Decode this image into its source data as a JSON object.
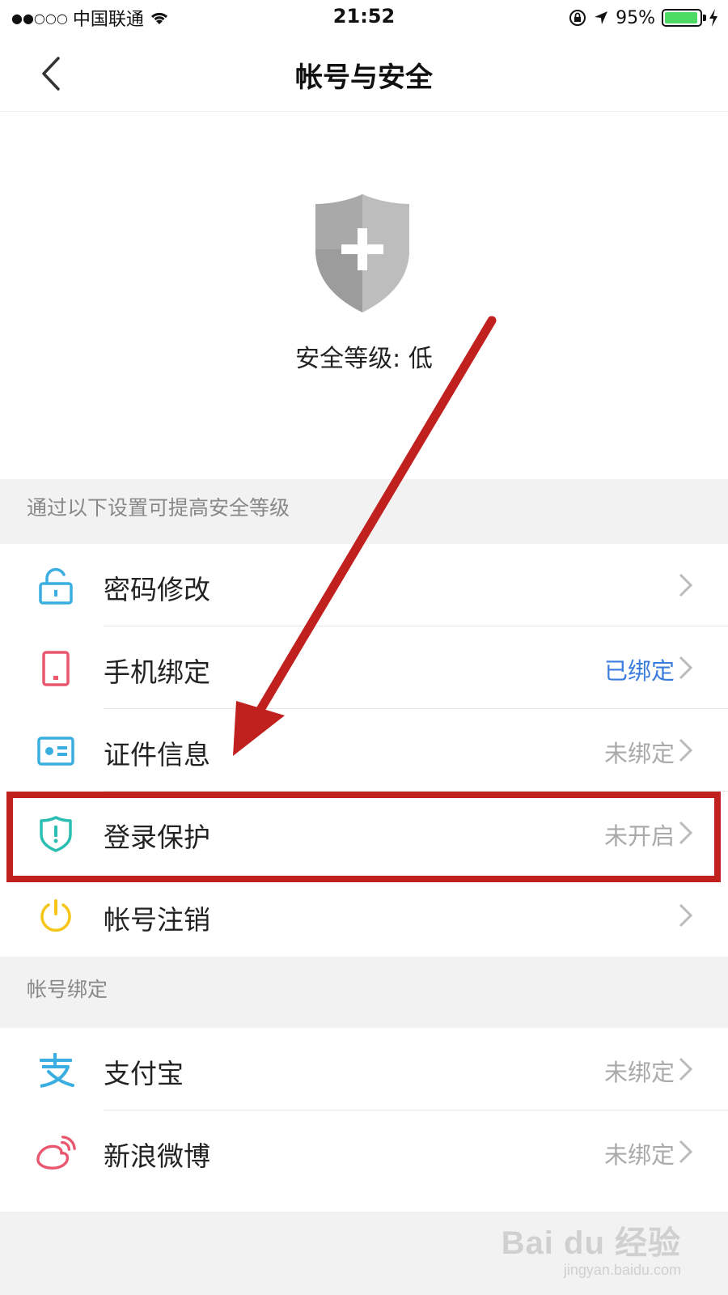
{
  "status_bar": {
    "carrier": "中国联通",
    "signal_dots": "●●○○○",
    "time": "21:52",
    "battery_percent": "95%",
    "battery_level": 0.95
  },
  "nav": {
    "title": "帐号与安全",
    "back_icon": "chevron-left-icon"
  },
  "hero": {
    "shield_icon": "shield-plus-icon",
    "security_level": "安全等级: 低"
  },
  "section_improve": {
    "header": "通过以下设置可提高安全等级",
    "items": [
      {
        "icon": "unlock-icon",
        "label": "密码修改",
        "status": "",
        "color": "#3aaee0"
      },
      {
        "icon": "phone-icon",
        "label": "手机绑定",
        "status": "已绑定",
        "color": "#e9566e"
      },
      {
        "icon": "id-card-icon",
        "label": "证件信息",
        "status": "未绑定",
        "color": "#3aaee0"
      },
      {
        "icon": "shield-alert-icon",
        "label": "登录保护",
        "status": "未开启",
        "color": "#2bbfb3"
      },
      {
        "icon": "power-icon",
        "label": "帐号注销",
        "status": "",
        "color": "#f5c518"
      }
    ]
  },
  "section_bind": {
    "header": "帐号绑定",
    "items": [
      {
        "icon": "alipay-icon",
        "label": "支付宝",
        "status": "未绑定",
        "color": "#3aaee0"
      },
      {
        "icon": "weibo-icon",
        "label": "新浪微博",
        "status": "未绑定",
        "color": "#e9566e"
      }
    ]
  },
  "annotation": {
    "color": "#c0201e"
  },
  "watermark": {
    "logo": "Bai du 经验",
    "url": "jingyan.baidu.com"
  }
}
